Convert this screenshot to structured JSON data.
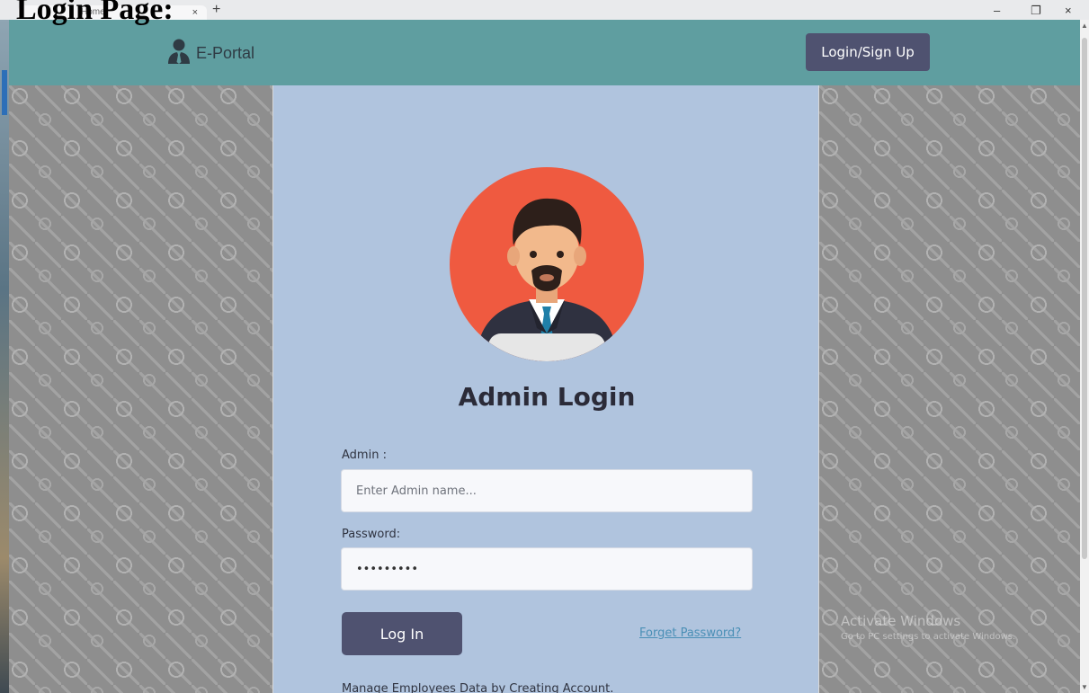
{
  "doc_heading": "Login Page:",
  "browser": {
    "tab_title": "Home",
    "tab_close": "×",
    "new_tab": "+",
    "minimize": "–",
    "restore": "❐",
    "close": "×"
  },
  "navbar": {
    "brand": "E-Portal",
    "login_signup": "Login/Sign Up"
  },
  "login": {
    "title": "Admin Login",
    "admin_label": "Admin :",
    "admin_placeholder": "Enter Admin name...",
    "admin_value": "",
    "password_label": "Password:",
    "password_value": "•••••••••",
    "login_button": "Log In",
    "forgot_link": "Forget Password?",
    "footer_text": "Manage Employees Data by Creating Account."
  },
  "watermark": {
    "line1": "Activate Windows",
    "line2": "Go to PC settings to activate Windows."
  },
  "colors": {
    "navbar": "#5f9ea0",
    "card": "#b0c4de",
    "button": "#4f5270",
    "avatar_circle": "#ef5a40",
    "link": "#4a8fb6"
  },
  "icons": [
    "user-tie-icon",
    "admin-avatar-icon",
    "close-icon",
    "plus-icon",
    "minimize-icon",
    "restore-icon"
  ]
}
